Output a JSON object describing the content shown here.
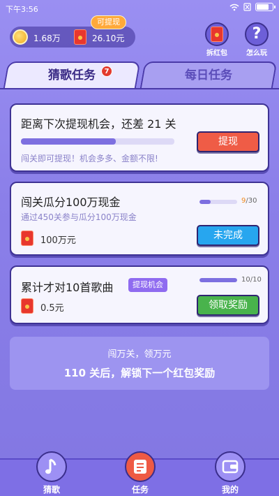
{
  "status_bar": {
    "time": "下午3:56"
  },
  "header": {
    "coins": "1.68万",
    "cash": "26.10元",
    "withdraw_tag": "可提现",
    "red_packet_label": "拆红包",
    "help_label": "怎么玩"
  },
  "tabs": [
    {
      "label": "猜歌任务",
      "badge": "7",
      "active": true
    },
    {
      "label": "每日任务",
      "active": false
    }
  ],
  "cards": [
    {
      "title": "距离下次提现机会，还差 21 关",
      "subtitle": "闯关即可提现！机会多多、金额不限!",
      "progress": 0.62,
      "button": "提现"
    },
    {
      "title": "闯关瓜分100万现金",
      "subtitle": "通过450关参与瓜分100万现金",
      "progress_current": "9",
      "progress_total": "/30",
      "progress": 0.3,
      "reward": "100万元",
      "button": "未完成"
    },
    {
      "title": "累计才对10首歌曲",
      "tag": "提现机会",
      "progress_text": "10/10",
      "progress": 1.0,
      "reward": "0.5元",
      "button": "领取奖励"
    }
  ],
  "info_banner": {
    "line1": "闯万关，领万元",
    "line2": "110 关后，解锁下一个红包奖励"
  },
  "bottom_nav": [
    {
      "label": "猜歌",
      "icon": "music-note-icon",
      "active": false
    },
    {
      "label": "任务",
      "icon": "task-list-icon",
      "active": true
    },
    {
      "label": "我的",
      "icon": "wallet-icon",
      "active": false
    }
  ],
  "colors": {
    "accent": "#8b7fe9",
    "danger": "#ef5c46",
    "info": "#27a6ef",
    "success": "#49b34c"
  }
}
